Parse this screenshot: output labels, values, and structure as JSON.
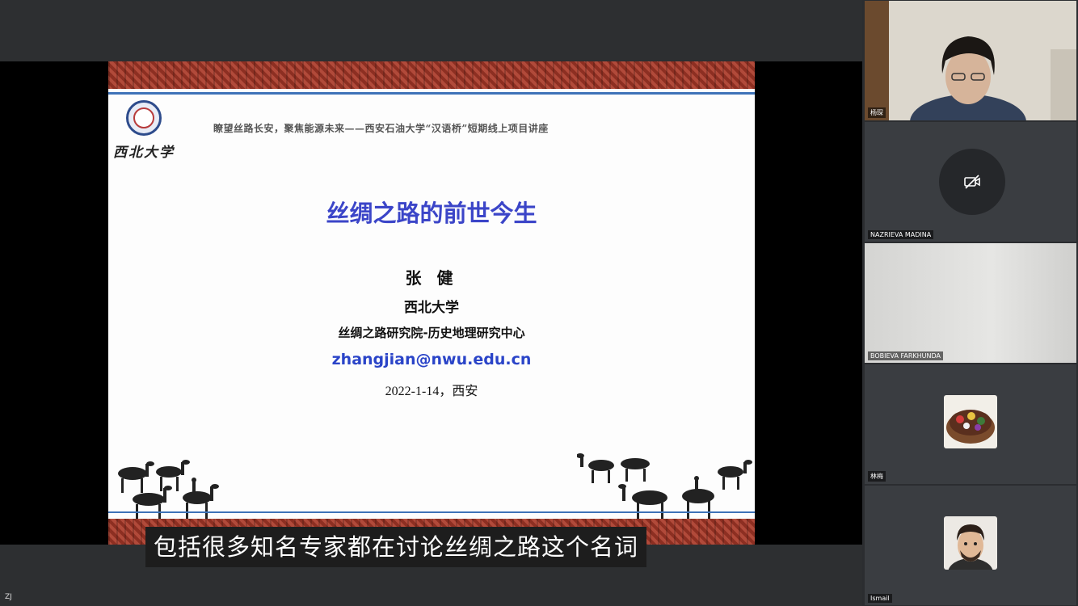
{
  "slide": {
    "logo_text": "西北大学",
    "banner": "瞭望丝路长安，聚焦能源未来——西安石油大学“汉语桥”短期线上项目讲座",
    "title": "丝绸之路的前世今生",
    "author": "张 健",
    "university": "西北大学",
    "institute": "丝绸之路研究院-历史地理研究中心",
    "email": "zhangjian@nwu.edu.cn",
    "date_place": "2022-1-14，西安"
  },
  "subtitle": "包括很多知名专家都在讨论丝绸之路这个名词",
  "presenter_label": "ZJ",
  "participants": [
    {
      "name": "杨琛",
      "video": "camera-on"
    },
    {
      "name": "NAZRIEVA MADINA",
      "video": "camera-off"
    },
    {
      "name": "BOBIEVA FARKHUNDA",
      "video": "camera-on"
    },
    {
      "name": "林梅",
      "video": "avatar"
    },
    {
      "name": "Ismail",
      "video": "avatar"
    }
  ],
  "colors": {
    "accent_blue": "#3b45c8",
    "band_red": "#b14a3a",
    "rule_blue": "#3e73b8"
  }
}
